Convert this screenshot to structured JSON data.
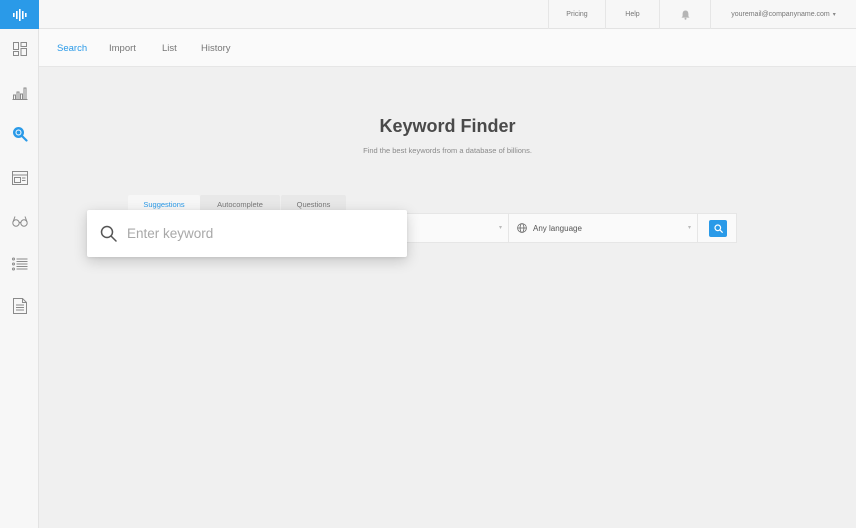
{
  "brand": {
    "accent": "#2a9ae8"
  },
  "rail": {
    "items": [
      {
        "icon": "dashboard-icon"
      },
      {
        "icon": "bar-chart-icon"
      },
      {
        "icon": "keyword-search-icon",
        "active": true
      },
      {
        "icon": "serp-layout-icon"
      },
      {
        "icon": "glasses-icon"
      },
      {
        "icon": "list-icon"
      },
      {
        "icon": "document-icon"
      }
    ]
  },
  "topbar": {
    "pricing": "Pricing",
    "help": "Help",
    "email": "youremail@companyname.com"
  },
  "subnav": {
    "search": "Search",
    "import": "Import",
    "list": "List",
    "history": "History"
  },
  "main": {
    "title": "Keyword Finder",
    "subtitle": "Find the best keywords from a database of billions.",
    "tabs": {
      "suggestions": "Suggestions",
      "autocomplete": "Autocomplete",
      "questions": "Questions"
    },
    "language": "Any language",
    "keyword_placeholder": "Enter keyword"
  }
}
